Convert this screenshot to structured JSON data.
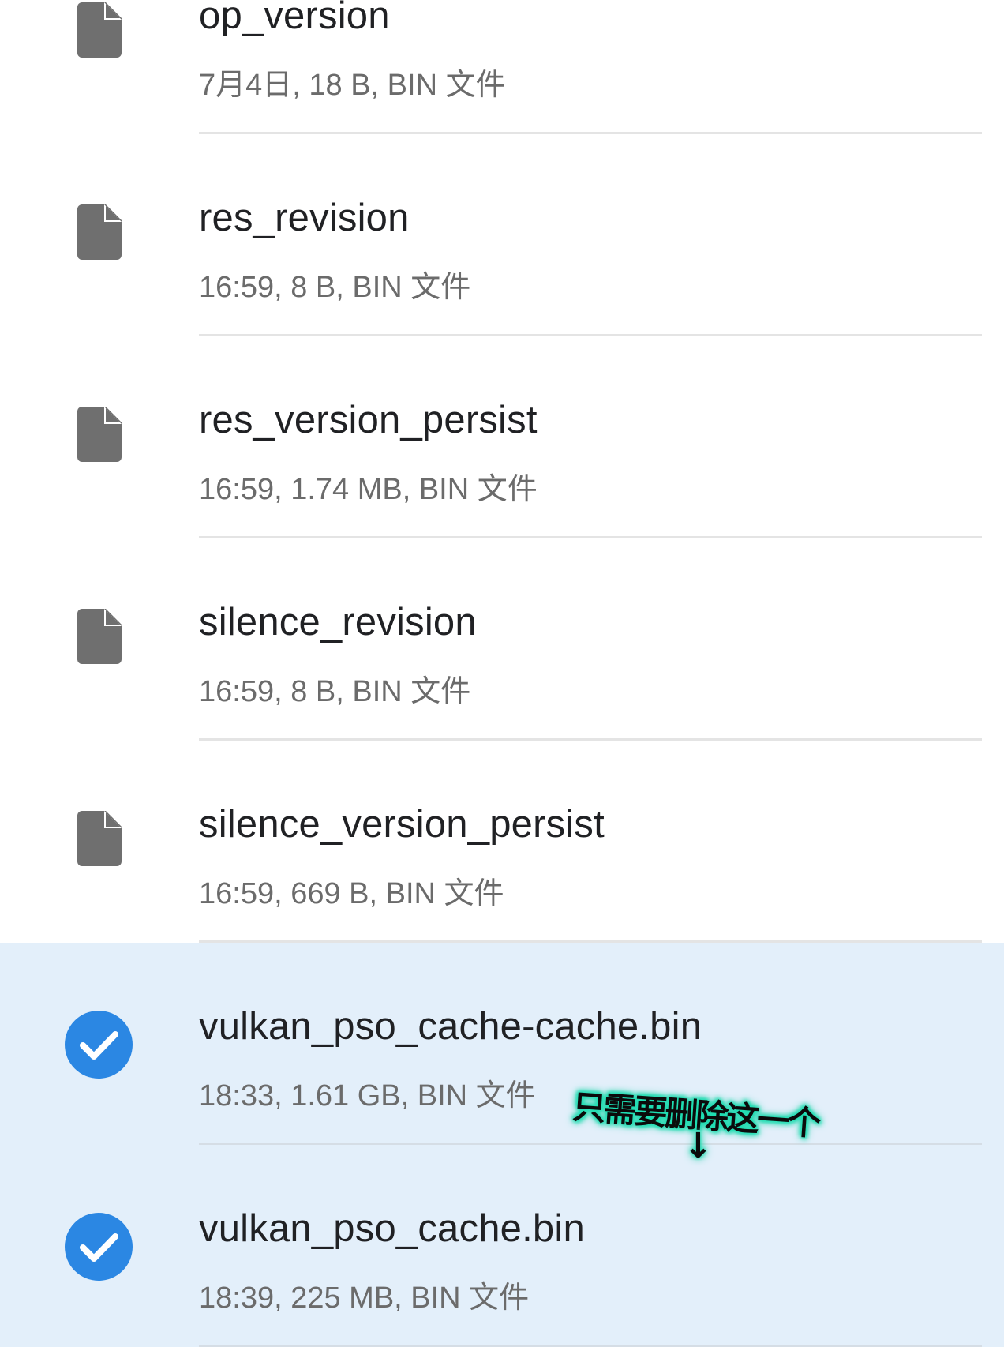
{
  "files": [
    {
      "name": "op_version",
      "meta": "7月4日, 18 B, BIN 文件",
      "selected": false,
      "icon": "file-icon"
    },
    {
      "name": "res_revision",
      "meta": "16:59, 8 B, BIN 文件",
      "selected": false,
      "icon": "file-icon"
    },
    {
      "name": "res_version_persist",
      "meta": "16:59, 1.74 MB, BIN 文件",
      "selected": false,
      "icon": "file-icon"
    },
    {
      "name": "silence_revision",
      "meta": "16:59, 8 B, BIN 文件",
      "selected": false,
      "icon": "file-icon"
    },
    {
      "name": "silence_version_persist",
      "meta": "16:59, 669 B, BIN 文件",
      "selected": false,
      "icon": "file-icon"
    },
    {
      "name": "vulkan_pso_cache-cache.bin",
      "meta": "18:33, 1.61 GB, BIN 文件",
      "selected": true,
      "icon": "check-circle-icon"
    },
    {
      "name": "vulkan_pso_cache.bin",
      "meta": "18:39, 225 MB, BIN 文件",
      "selected": true,
      "icon": "check-circle-icon"
    }
  ],
  "annotation": {
    "text": "只需要删除这一个",
    "arrow": "↓",
    "glow_color": "#1fe0b4"
  },
  "colors": {
    "selected_background": "#e3effa",
    "check_blue": "#2b87e3",
    "file_icon_gray": "#6f6f6f",
    "name_text": "#202124",
    "meta_text": "#6b6b6b"
  }
}
